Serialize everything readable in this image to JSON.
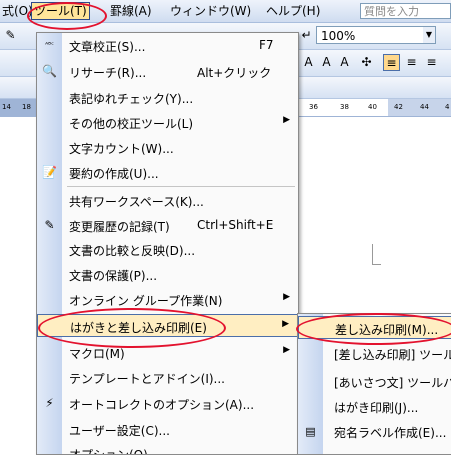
{
  "menubar": {
    "items": [
      {
        "label": "式(O)"
      },
      {
        "label": "ツール(T)"
      },
      {
        "label": "罫線(A)"
      },
      {
        "label": "ウィンドウ(W)"
      },
      {
        "label": "ヘルプ(H)"
      }
    ],
    "help_placeholder": "質問を入力"
  },
  "toolbar": {
    "zoom_value": "100%",
    "format_buttons": [
      "A",
      "A",
      "A"
    ]
  },
  "ruler": {
    "left_ticks": [
      "14",
      "18"
    ],
    "right_ticks": [
      "36",
      "38",
      "40",
      "42",
      "44",
      "4"
    ]
  },
  "tools_menu": {
    "items": [
      {
        "label": "文章校正(S)...",
        "shortcut": "F7",
        "icon": "spellcheck-icon",
        "glyph": "ᴬᴮᶜ"
      },
      {
        "label": "リサーチ(R)...",
        "shortcut": "Alt+クリック",
        "icon": "research-icon",
        "glyph": "🔍"
      },
      {
        "label": "表記ゆれチェック(Y)...",
        "shortcut": "",
        "icon": "",
        "glyph": ""
      },
      {
        "label": "その他の校正ツール(L)",
        "shortcut": "",
        "icon": "",
        "glyph": "",
        "submenu": true
      },
      {
        "label": "文字カウント(W)...",
        "shortcut": "",
        "icon": "",
        "glyph": ""
      },
      {
        "label": "要約の作成(U)...",
        "shortcut": "",
        "icon": "summary-icon",
        "glyph": "📝"
      },
      {
        "label": "共有ワークスペース(K)...",
        "shortcut": "",
        "icon": "",
        "glyph": ""
      },
      {
        "label": "変更履歴の記録(T)",
        "shortcut": "Ctrl+Shift+E",
        "icon": "track-changes-icon",
        "glyph": "✎"
      },
      {
        "label": "文書の比較と反映(D)...",
        "shortcut": "",
        "icon": "",
        "glyph": ""
      },
      {
        "label": "文書の保護(P)...",
        "shortcut": "",
        "icon": "",
        "glyph": ""
      },
      {
        "label": "オンライン グループ作業(N)",
        "shortcut": "",
        "icon": "",
        "glyph": "",
        "submenu": true
      },
      {
        "label": "はがきと差し込み印刷(E)",
        "shortcut": "",
        "icon": "",
        "glyph": "",
        "submenu": true
      },
      {
        "label": "マクロ(M)",
        "shortcut": "",
        "icon": "",
        "glyph": "",
        "submenu": true
      },
      {
        "label": "テンプレートとアドイン(I)...",
        "shortcut": "",
        "icon": "",
        "glyph": ""
      },
      {
        "label": "オートコレクトのオプション(A)...",
        "shortcut": "",
        "icon": "autocorrect-icon",
        "glyph": "⚡"
      },
      {
        "label": "ユーザー設定(C)...",
        "shortcut": "",
        "icon": "",
        "glyph": ""
      },
      {
        "label": "オプション(O)...",
        "shortcut": "",
        "icon": "",
        "glyph": ""
      }
    ]
  },
  "mailmerge_submenu": {
    "items": [
      {
        "label": "差し込み印刷(M)...",
        "icon": "",
        "glyph": ""
      },
      {
        "label": "[差し込み印刷] ツール",
        "icon": "",
        "glyph": ""
      },
      {
        "label": "[あいさつ文] ツールバ",
        "icon": "",
        "glyph": ""
      },
      {
        "label": "はがき印刷(J)...",
        "icon": "",
        "glyph": ""
      },
      {
        "label": "宛名ラベル作成(E)...",
        "icon": "address-label-icon",
        "glyph": "▤"
      }
    ]
  },
  "colors": {
    "highlight_fill": "#ffeec2",
    "highlight_border": "#4b6ea9",
    "annotation_oval": "#e3122e"
  }
}
